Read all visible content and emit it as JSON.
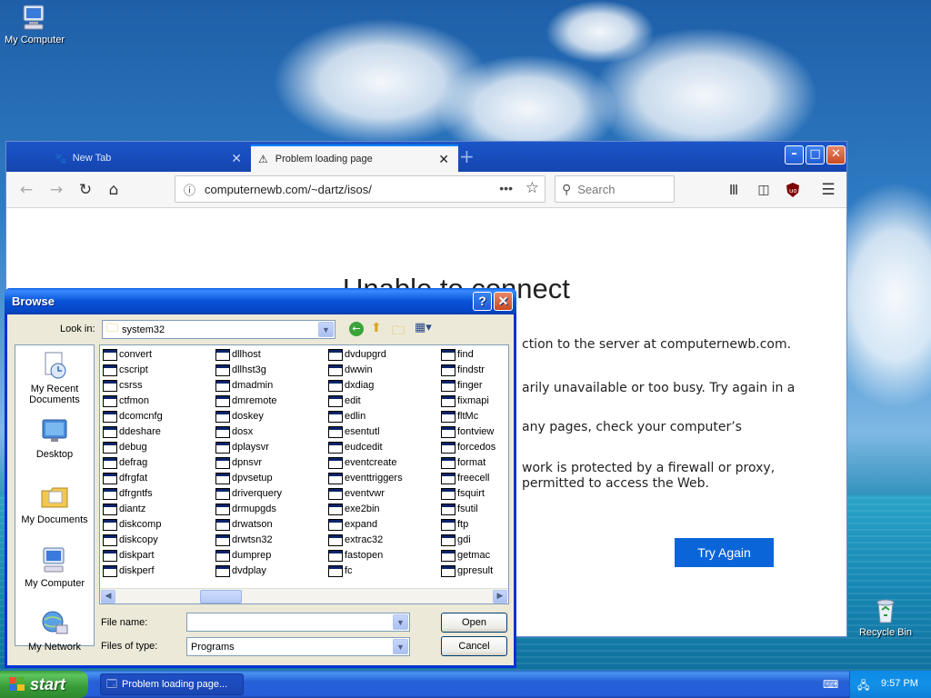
{
  "desktop": {
    "icons": [
      {
        "label": "My Computer"
      },
      {
        "label": "Recycle Bin"
      }
    ]
  },
  "browser": {
    "tabs": [
      {
        "label": "New Tab",
        "active": false
      },
      {
        "label": "Problem loading page",
        "active": true
      }
    ],
    "url": "computernewb.com/~dartz/isos/",
    "search_placeholder": "Search",
    "error": {
      "title": "Unable to connect",
      "line1": "ction to the server at computernewb.com.",
      "line2": "arily unavailable or too busy. Try again in a",
      "line3": "any pages, check your computer’s",
      "line4": "work is protected by a firewall or proxy,",
      "line5": "permitted to access the Web.",
      "button": "Try Again"
    },
    "accent_color": "#0a66d8"
  },
  "dialog": {
    "title": "Browse",
    "look_in_label": "Look in:",
    "look_in_value": "system32",
    "places": [
      "My Recent Documents",
      "Desktop",
      "My Documents",
      "My Computer",
      "My Network"
    ],
    "files": [
      [
        "convert",
        "cscript",
        "csrss",
        "ctfmon",
        "dcomcnfg",
        "ddeshare",
        "debug",
        "defrag",
        "dfrgfat",
        "dfrgntfs",
        "diantz",
        "diskcomp",
        "diskcopy",
        "diskpart",
        "diskperf"
      ],
      [
        "dllhost",
        "dllhst3g",
        "dmadmin",
        "dmremote",
        "doskey",
        "dosx",
        "dplaysvr",
        "dpnsvr",
        "dpvsetup",
        "driverquery",
        "drmupgds",
        "drwatson",
        "drwtsn32",
        "dumprep",
        "dvdplay"
      ],
      [
        "dvdupgrd",
        "dwwin",
        "dxdiag",
        "edit",
        "edlin",
        "esentutl",
        "eudcedit",
        "eventcreate",
        "eventtriggers",
        "eventvwr",
        "exe2bin",
        "expand",
        "extrac32",
        "fastopen",
        "fc"
      ],
      [
        "find",
        "findstr",
        "finger",
        "fixmapi",
        "fltMc",
        "fontview",
        "forcedos",
        "format",
        "freecell",
        "fsquirt",
        "fsutil",
        "ftp",
        "gdi",
        "getmac",
        "gpresult"
      ]
    ],
    "file_name_label": "File name:",
    "file_name_value": "",
    "files_of_type_label": "Files of type:",
    "files_of_type_value": "Programs",
    "open_label": "Open",
    "cancel_label": "Cancel"
  },
  "taskbar": {
    "start_label": "start",
    "task_label": "Problem loading page...",
    "clock": "9:57 PM"
  }
}
